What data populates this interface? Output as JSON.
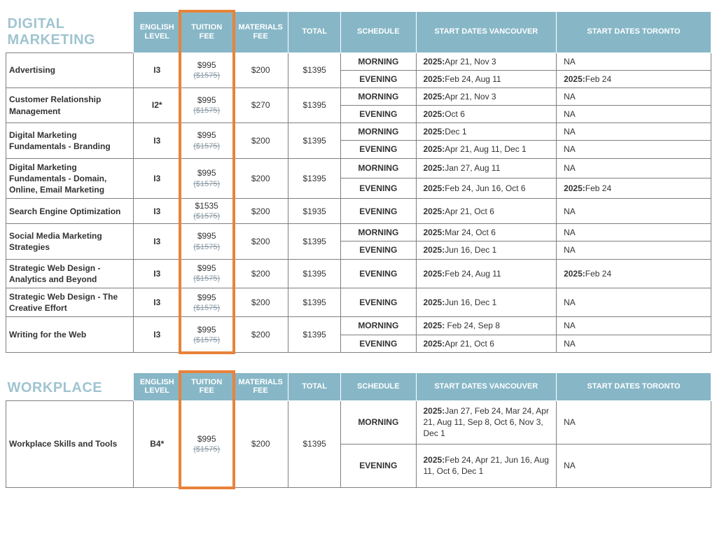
{
  "sections": [
    {
      "title": "DIGITAL MARKETING",
      "headers": [
        "ENGLISH LEVEL",
        "TUITION FEE",
        "MATERIALS FEE",
        "TOTAL",
        "SCHEDULE",
        "START DATES VANCOUVER",
        "START DATES TORONTO"
      ],
      "courses": [
        {
          "name": "Advertising",
          "level": "I3",
          "tuition": "$995",
          "tuition_strike": "($1575)",
          "materials": "$200",
          "total": "$1395",
          "rows": [
            {
              "schedule": "MORNING",
              "van_year": "2025:",
              "van": "Apr 21, Nov 3",
              "tor_year": "",
              "tor": "NA"
            },
            {
              "schedule": "EVENING",
              "van_year": "2025:",
              "van": "Feb 24, Aug 11",
              "tor_year": "2025:",
              "tor": "Feb 24"
            }
          ]
        },
        {
          "name": "Customer Relationship Management",
          "level": "I2*",
          "tuition": "$995",
          "tuition_strike": "($1575)",
          "materials": "$270",
          "total": "$1395",
          "rows": [
            {
              "schedule": "MORNING",
              "van_year": "2025:",
              "van": "Apr 21, Nov 3",
              "tor_year": "",
              "tor": "NA"
            },
            {
              "schedule": "EVENING",
              "van_year": "2025:",
              "van": "Oct 6",
              "tor_year": "",
              "tor": "NA"
            }
          ]
        },
        {
          "name": "Digital Marketing Fundamentals - Branding",
          "level": "I3",
          "tuition": "$995",
          "tuition_strike": "($1575)",
          "materials": "$200",
          "total": "$1395",
          "rows": [
            {
              "schedule": "MORNING",
              "van_year": "2025:",
              "van": "Dec 1",
              "tor_year": "",
              "tor": "NA"
            },
            {
              "schedule": "EVENING",
              "van_year": "2025:",
              "van": "Apr 21, Aug 11, Dec 1",
              "tor_year": "",
              "tor": "NA"
            }
          ]
        },
        {
          "name": "Digital Marketing Fundamentals - Domain, Online, Email Marketing",
          "level": "I3",
          "tuition": "$995",
          "tuition_strike": "($1575)",
          "materials": "$200",
          "total": "$1395",
          "rows": [
            {
              "schedule": "MORNING",
              "van_year": "2025:",
              "van": "Jan 27, Aug 11",
              "tor_year": "",
              "tor": "NA"
            },
            {
              "schedule": "EVENING",
              "van_year": "2025:",
              "van": "Feb 24, Jun 16, Oct 6",
              "tor_year": "2025:",
              "tor": "Feb 24"
            }
          ]
        },
        {
          "name": "Search Engine Optimization",
          "level": "I3",
          "tuition": "$1535",
          "tuition_strike": "($1575)",
          "materials": "$200",
          "total": "$1935",
          "rows": [
            {
              "schedule": "EVENING",
              "van_year": "2025:",
              "van": "Apr 21, Oct 6",
              "tor_year": "",
              "tor": "NA"
            }
          ]
        },
        {
          "name": "Social Media Marketing Strategies",
          "level": "I3",
          "tuition": "$995",
          "tuition_strike": "($1575)",
          "materials": "$200",
          "total": "$1395",
          "rows": [
            {
              "schedule": "MORNING",
              "van_year": "2025:",
              "van": "Mar 24, Oct 6",
              "tor_year": "",
              "tor": "NA"
            },
            {
              "schedule": "EVENING",
              "van_year": "2025:",
              "van": "Jun 16, Dec 1",
              "tor_year": "",
              "tor": "NA"
            }
          ]
        },
        {
          "name": "Strategic Web Design - Analytics and Beyond",
          "level": "I3",
          "tuition": "$995",
          "tuition_strike": "($1575)",
          "materials": "$200",
          "total": "$1395",
          "rows": [
            {
              "schedule": "EVENING",
              "van_year": "2025:",
              "van": "Feb 24, Aug 11",
              "tor_year": "2025:",
              "tor": "Feb 24"
            }
          ]
        },
        {
          "name": "Strategic Web Design - The Creative Effort",
          "level": "I3",
          "tuition": "$995",
          "tuition_strike": "($1575)",
          "materials": "$200",
          "total": "$1395",
          "rows": [
            {
              "schedule": "EVENING",
              "van_year": "2025:",
              "van": "Jun 16, Dec 1",
              "tor_year": "",
              "tor": "NA"
            }
          ]
        },
        {
          "name": "Writing for the Web",
          "level": "I3",
          "tuition": "$995",
          "tuition_strike": "($1575)",
          "materials": "$200",
          "total": "$1395",
          "rows": [
            {
              "schedule": "MORNING",
              "van_year": "2025:",
              "van": " Feb 24, Sep 8",
              "tor_year": "",
              "tor": "NA"
            },
            {
              "schedule": "EVENING",
              "van_year": "2025:",
              "van": "Apr 21, Oct 6",
              "tor_year": "",
              "tor": "NA"
            }
          ]
        }
      ]
    },
    {
      "title": "WORKPLACE",
      "headers": [
        "ENGLISH LEVEL",
        "TUITION FEE",
        "MATERIALS FEE",
        "TOTAL",
        "SCHEDULE",
        "START DATES VANCOUVER",
        "START DATES TORONTO"
      ],
      "courses": [
        {
          "name": "Workplace Skills and Tools",
          "level": "B4*",
          "tuition": "$995",
          "tuition_strike": "($1575)",
          "materials": "$200",
          "total": "$1395",
          "rows": [
            {
              "schedule": "MORNING",
              "van_year": "2025:",
              "van": "Jan 27, Feb 24, Mar 24, Apr 21, Aug 11, Sep 8, Oct 6, Nov 3, Dec 1",
              "tor_year": "",
              "tor": "NA",
              "tall": true
            },
            {
              "schedule": "EVENING",
              "van_year": "2025:",
              "van": "Feb 24, Apr 21, Jun 16, Aug 11, Oct 6, Dec 1",
              "tor_year": "",
              "tor": "NA",
              "tall": true
            }
          ]
        }
      ]
    }
  ]
}
